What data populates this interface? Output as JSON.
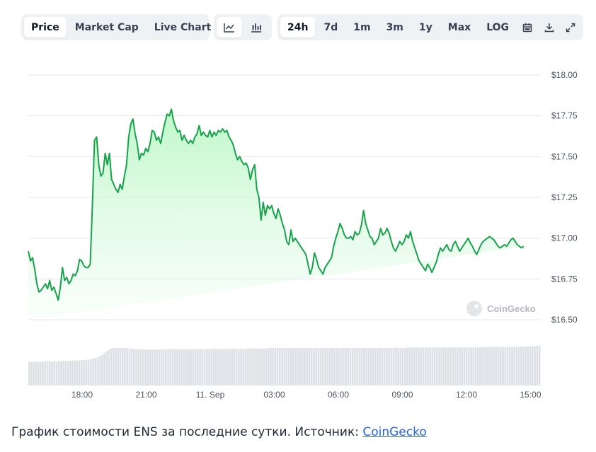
{
  "toolbar": {
    "metric_tabs": [
      {
        "label": "Price",
        "active": true
      },
      {
        "label": "Market Cap",
        "active": false
      },
      {
        "label": "Live Chart",
        "active": false
      }
    ],
    "chart_type_icons": [
      "line-chart-icon",
      "candlestick-chart-icon"
    ],
    "range_tabs": [
      {
        "label": "24h",
        "active": true
      },
      {
        "label": "7d",
        "active": false
      },
      {
        "label": "1m",
        "active": false
      },
      {
        "label": "3m",
        "active": false
      },
      {
        "label": "1y",
        "active": false
      },
      {
        "label": "Max",
        "active": false
      },
      {
        "label": "LOG",
        "active": false
      }
    ],
    "tool_icons": [
      "calendar-icon",
      "download-icon",
      "fullscreen-icon"
    ]
  },
  "watermark": "CoinGecko",
  "caption": {
    "text": "График стоимости ENS за последние сутки. Источник: ",
    "link_text": "CoinGecko"
  },
  "colors": {
    "line": "#16a34a",
    "area_top": "#bbf7c6",
    "volume": "#d1d5db",
    "grid": "#e5e7eb",
    "link": "#2563eb"
  },
  "chart_data": {
    "type": "area",
    "title": "",
    "xlabel": "",
    "ylabel": "",
    "ylim": [
      16.5,
      18.0
    ],
    "yticks": [
      "$18.00",
      "$17.75",
      "$17.50",
      "$17.25",
      "$17.00",
      "$16.75",
      "$16.50"
    ],
    "ytick_values": [
      18.0,
      17.75,
      17.5,
      17.25,
      17.0,
      16.75,
      16.5
    ],
    "xticks": [
      "18:00",
      "21:00",
      "11. Sep",
      "03:00",
      "06:00",
      "09:00",
      "12:00",
      "15:00"
    ],
    "xtick_hours": [
      2.52,
      5.52,
      8.52,
      11.52,
      14.52,
      17.52,
      20.52,
      23.52
    ],
    "grid": true,
    "series": [
      {
        "x_hours": [
          0.0,
          0.1,
          0.2,
          0.3,
          0.4,
          0.5,
          0.6,
          0.7,
          0.8,
          0.9,
          1.0,
          1.1,
          1.2,
          1.3,
          1.4,
          1.5,
          1.6,
          1.7,
          1.8,
          1.9,
          2.0,
          2.1,
          2.2,
          2.3,
          2.4,
          2.5,
          2.6,
          2.7,
          2.8,
          2.9,
          3.0,
          3.1,
          3.2,
          3.3,
          3.4,
          3.5,
          3.6,
          3.7,
          3.8,
          3.9,
          4.0,
          4.1,
          4.2,
          4.3,
          4.4,
          4.5,
          4.6,
          4.7,
          4.8,
          4.9,
          5.0,
          5.1,
          5.2,
          5.3,
          5.4,
          5.5,
          5.6,
          5.7,
          5.8,
          5.9,
          6.0,
          6.1,
          6.2,
          6.3,
          6.4,
          6.5,
          6.6,
          6.7,
          6.8,
          6.9,
          7.0,
          7.1,
          7.2,
          7.3,
          7.4,
          7.5,
          7.6,
          7.7,
          7.8,
          7.9,
          8.0,
          8.1,
          8.2,
          8.3,
          8.4,
          8.5,
          8.6,
          8.7,
          8.8,
          8.9,
          9.0,
          9.1,
          9.2,
          9.3,
          9.4,
          9.5,
          9.6,
          9.7,
          9.8,
          9.9,
          10.0,
          10.1,
          10.2,
          10.3,
          10.4,
          10.5,
          10.6,
          10.7,
          10.8,
          10.9,
          11.0,
          11.1,
          11.2,
          11.3,
          11.4,
          11.5,
          11.6,
          11.7,
          11.8,
          11.9,
          12.0,
          12.1,
          12.2,
          12.3,
          12.4,
          12.5,
          12.6,
          12.7,
          12.8,
          12.9,
          13.0,
          13.1,
          13.2,
          13.3,
          13.4,
          13.5,
          13.6,
          13.7,
          13.8,
          13.9,
          14.0,
          14.1,
          14.2,
          14.3,
          14.4,
          14.5,
          14.6,
          14.7,
          14.8,
          14.9,
          15.0,
          15.1,
          15.2,
          15.3,
          15.4,
          15.5,
          15.6,
          15.7,
          15.8,
          15.9,
          16.0,
          16.1,
          16.2,
          16.3,
          16.4,
          16.5,
          16.6,
          16.7,
          16.8,
          16.9,
          17.0,
          17.1,
          17.2,
          17.3,
          17.4,
          17.5,
          17.6,
          17.7,
          17.8,
          17.9,
          18.0,
          18.1,
          18.2,
          18.3,
          18.4,
          18.5,
          18.6,
          18.7,
          18.8,
          18.9,
          19.0,
          19.1,
          19.2,
          19.3,
          19.4,
          19.5,
          19.6,
          19.7,
          19.8,
          19.9,
          20.0,
          20.1,
          20.2,
          20.3,
          20.4,
          20.5,
          20.6,
          20.7,
          20.8,
          20.9,
          21.0,
          21.1,
          21.2,
          21.3,
          21.4,
          21.5,
          21.6,
          21.7,
          21.8,
          21.9,
          22.0,
          22.1,
          22.2,
          22.3,
          22.4,
          22.5,
          22.6,
          22.7,
          22.8,
          22.9,
          23.0,
          23.1,
          23.2,
          23.3,
          23.4,
          23.5,
          23.6,
          23.7,
          23.8,
          23.9,
          24.0
        ],
        "values": [
          16.92,
          16.86,
          16.88,
          16.81,
          16.72,
          16.67,
          16.68,
          16.7,
          16.72,
          16.69,
          16.74,
          16.68,
          16.7,
          16.66,
          16.62,
          16.7,
          16.82,
          16.74,
          16.76,
          16.72,
          16.74,
          16.78,
          16.77,
          16.8,
          16.87,
          16.86,
          16.83,
          16.82,
          16.82,
          16.84,
          17.2,
          17.6,
          17.62,
          17.45,
          17.38,
          17.4,
          17.52,
          17.45,
          17.52,
          17.36,
          17.33,
          17.3,
          17.28,
          17.33,
          17.3,
          17.38,
          17.45,
          17.62,
          17.7,
          17.73,
          17.64,
          17.58,
          17.48,
          17.52,
          17.51,
          17.55,
          17.53,
          17.58,
          17.66,
          17.65,
          17.6,
          17.62,
          17.58,
          17.65,
          17.71,
          17.76,
          17.75,
          17.79,
          17.72,
          17.68,
          17.65,
          17.66,
          17.6,
          17.63,
          17.6,
          17.58,
          17.6,
          17.58,
          17.62,
          17.64,
          17.69,
          17.63,
          17.65,
          17.63,
          17.62,
          17.66,
          17.62,
          17.65,
          17.63,
          17.66,
          17.65,
          17.67,
          17.65,
          17.66,
          17.62,
          17.6,
          17.57,
          17.52,
          17.48,
          17.5,
          17.47,
          17.45,
          17.46,
          17.43,
          17.36,
          17.42,
          17.45,
          17.3,
          17.25,
          17.11,
          17.22,
          17.14,
          17.2,
          17.18,
          17.2,
          17.15,
          17.12,
          17.18,
          17.14,
          17.09,
          17.05,
          16.98,
          16.96,
          17.05,
          16.98,
          17.0,
          16.98,
          16.96,
          16.94,
          16.92,
          16.9,
          16.84,
          16.78,
          16.82,
          16.91,
          16.87,
          16.82,
          16.8,
          16.78,
          16.82,
          16.84,
          16.86,
          16.88,
          16.95,
          17.0,
          17.04,
          17.09,
          17.06,
          17.02,
          17.0,
          17.0,
          17.01,
          16.99,
          17.04,
          17.02,
          17.03,
          17.08,
          17.17,
          17.09,
          17.05,
          17.01,
          17.0,
          16.96,
          16.98,
          17.0,
          17.06,
          17.02,
          17.03,
          17.06,
          17.03,
          16.98,
          16.94,
          16.92,
          16.95,
          16.98,
          16.96,
          16.98,
          17.02,
          17.0,
          17.04,
          16.98,
          16.94,
          16.9,
          16.86,
          16.84,
          16.82,
          16.8,
          16.84,
          16.82,
          16.79,
          16.82,
          16.85,
          16.9,
          16.94,
          16.92,
          16.94,
          16.96,
          16.93,
          16.92,
          16.96,
          16.98,
          16.95,
          16.92,
          16.94,
          16.96,
          16.98,
          17.0,
          16.97,
          16.95,
          16.92,
          16.9,
          16.93,
          16.96,
          16.98,
          16.99,
          17.0,
          17.01,
          17.0,
          16.99,
          16.97,
          16.95,
          16.94,
          16.95,
          16.96,
          16.95,
          16.97,
          16.99,
          17.0,
          16.98,
          16.96,
          16.95,
          16.94,
          16.95
        ]
      }
    ],
    "volume_values": [
      0.43,
      0.43,
      0.43,
      0.43,
      0.43,
      0.43,
      0.43,
      0.44,
      0.44,
      0.44,
      0.43,
      0.44,
      0.43,
      0.45,
      0.44,
      0.45,
      0.44,
      0.44,
      0.45,
      0.45,
      0.46,
      0.45,
      0.46,
      0.46,
      0.46,
      0.47,
      0.47,
      0.48,
      0.49,
      0.5,
      0.51,
      0.53,
      0.56,
      0.59,
      0.62,
      0.65,
      0.67,
      0.68,
      0.68,
      0.68,
      0.68,
      0.68,
      0.68,
      0.68,
      0.67,
      0.67,
      0.66,
      0.66,
      0.66,
      0.66,
      0.65,
      0.65,
      0.65,
      0.65,
      0.65,
      0.65,
      0.65,
      0.65,
      0.66,
      0.65,
      0.66,
      0.66,
      0.66,
      0.66,
      0.66,
      0.66,
      0.66,
      0.66,
      0.66,
      0.66,
      0.66,
      0.66,
      0.66,
      0.66,
      0.66,
      0.66,
      0.66,
      0.66,
      0.66,
      0.66,
      0.66,
      0.67,
      0.66,
      0.66,
      0.66,
      0.66,
      0.66,
      0.66,
      0.67,
      0.66,
      0.67,
      0.66,
      0.66,
      0.67,
      0.66,
      0.67,
      0.67,
      0.67,
      0.67,
      0.67,
      0.67,
      0.67,
      0.67,
      0.67,
      0.67,
      0.68,
      0.68,
      0.68,
      0.68,
      0.68,
      0.68,
      0.68,
      0.68,
      0.68,
      0.68,
      0.68,
      0.68,
      0.68,
      0.68,
      0.68,
      0.68,
      0.68,
      0.68,
      0.68,
      0.68,
      0.68,
      0.68,
      0.68,
      0.68,
      0.68,
      0.68,
      0.68,
      0.68,
      0.68,
      0.68,
      0.68,
      0.68,
      0.68,
      0.68,
      0.68,
      0.68,
      0.68,
      0.68,
      0.68,
      0.68,
      0.68,
      0.68,
      0.68,
      0.68,
      0.68,
      0.68,
      0.68,
      0.68,
      0.68,
      0.68,
      0.68,
      0.68,
      0.68,
      0.68,
      0.68,
      0.68,
      0.69,
      0.68,
      0.68,
      0.68,
      0.68,
      0.69,
      0.69,
      0.69,
      0.69,
      0.69,
      0.69,
      0.69,
      0.69,
      0.69,
      0.69,
      0.69,
      0.69,
      0.69,
      0.69,
      0.69,
      0.69,
      0.69,
      0.69,
      0.69,
      0.69,
      0.69,
      0.69,
      0.69,
      0.69,
      0.69,
      0.69,
      0.69,
      0.69,
      0.69,
      0.69,
      0.69,
      0.69,
      0.69,
      0.7,
      0.69,
      0.7,
      0.7,
      0.7,
      0.7,
      0.7,
      0.7,
      0.7,
      0.7,
      0.7,
      0.7,
      0.7,
      0.7,
      0.7,
      0.7,
      0.7,
      0.71,
      0.7,
      0.71,
      0.71,
      0.71,
      0.71,
      0.71,
      0.72,
      0.72
    ]
  }
}
